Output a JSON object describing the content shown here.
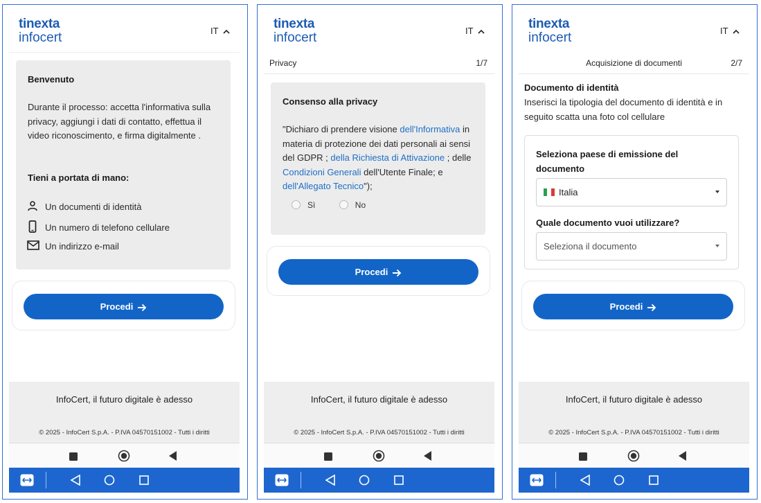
{
  "brand": {
    "line1": "tinexta",
    "line2": "infocert"
  },
  "language": {
    "code": "IT"
  },
  "footer": {
    "tagline": "InfoCert, il futuro digitale è adesso",
    "copyright": "© 2025 - InfoCert S.p.A. - P.IVA 04570151002 - Tutti i diritti"
  },
  "proceed_label": "Procedi",
  "colors": {
    "brand_blue": "#1c5bb3",
    "button_blue": "#1265c7",
    "link_blue": "#1f6fc4",
    "teamviewer_bar": "#1e66cf"
  },
  "icons": {
    "person": "person-icon",
    "phone": "phone-icon",
    "mail": "mail-icon",
    "chevron": "chevron-up-icon",
    "arrow": "arrow-right-icon",
    "android_nav": [
      "square-icon",
      "circle-icon",
      "triangle-back-icon"
    ],
    "teamviewer": [
      "teamviewer-icon",
      "back-icon",
      "home-icon",
      "recents-icon"
    ]
  },
  "screen1": {
    "card_title": "Benvenuto",
    "intro": "Durante il processo: accetta l'informativa sulla privacy, aggiungi i dati di contatto, effettua il video riconoscimento, e firma digitalmente .",
    "checklist_title": "Tieni a portata di mano:",
    "items": [
      "Un documenti di identità",
      "Un numero di telefono cellulare",
      "Un indirizzo e-mail"
    ]
  },
  "screen2": {
    "step_label": "Privacy",
    "step_count": "1/7",
    "card_title": "Consenso alla privacy",
    "consent": {
      "t1": "\"Dichiaro di prendere visione ",
      "l1": "dell'Informativa",
      "t2": " in materia di protezione dei dati personali ai sensi del GDPR ; ",
      "l2": "della Richiesta di Attivazione",
      "t3": " ; delle ",
      "l3": "Condizioni Generali",
      "t4": " dell'Utente Finale; e ",
      "l4": "dell'Allegato Tecnico",
      "t5": "\");"
    },
    "options": [
      "Sì",
      "No"
    ]
  },
  "screen3": {
    "step_label": "Acquisizione di documenti",
    "step_count": "2/7",
    "section_title": "Documento di identità",
    "description": "Inserisci la tipologia del documento di identità e in seguito scatta una foto col cellulare",
    "country_label": "Seleziona paese di emissione del documento",
    "country_value": "Italia",
    "document_label": "Quale documento vuoi utilizzare?",
    "document_placeholder": "Seleziona il documento"
  }
}
